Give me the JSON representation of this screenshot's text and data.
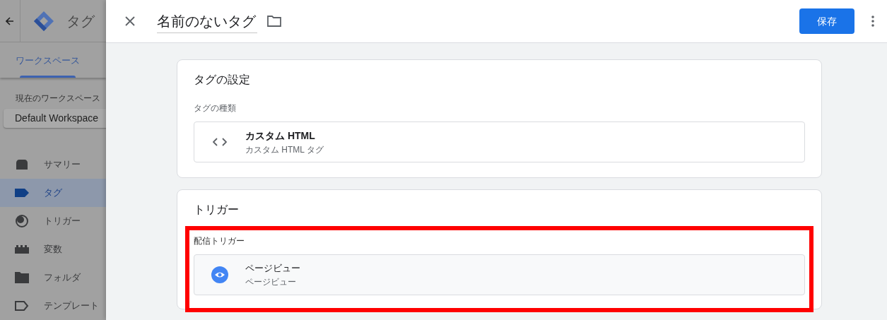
{
  "background_app": {
    "title": "タグ",
    "tabs": [
      {
        "label": "ワークスペース",
        "selected": true
      }
    ],
    "workspace_label": "現在のワークスペース",
    "workspace_name": "Default Workspace",
    "nav": [
      {
        "label": "サマリー",
        "kind": "summary",
        "selected": false
      },
      {
        "label": "タグ",
        "kind": "tag",
        "selected": true
      },
      {
        "label": "トリガー",
        "kind": "trigger",
        "selected": false
      },
      {
        "label": "変数",
        "kind": "variable",
        "selected": false
      },
      {
        "label": "フォルダ",
        "kind": "folder",
        "selected": false
      },
      {
        "label": "テンプレート",
        "kind": "template",
        "selected": false
      }
    ]
  },
  "panel": {
    "title": "名前のないタグ",
    "save_button": "保存",
    "tag_config": {
      "heading": "タグの設定",
      "type_label": "タグの種類",
      "type_name": "カスタム HTML",
      "type_description": "カスタム HTML タグ"
    },
    "triggering": {
      "heading": "トリガー",
      "highlighted": true,
      "label": "配信トリガー",
      "trigger_name": "ページビュー",
      "trigger_description": "ページビュー"
    }
  }
}
